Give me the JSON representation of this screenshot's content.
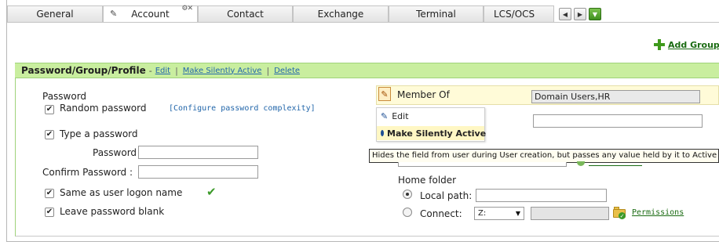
{
  "tabs": [
    {
      "label": "General",
      "active": false
    },
    {
      "label": "Account",
      "active": true
    },
    {
      "label": "Contact",
      "active": false
    },
    {
      "label": "Exchange",
      "active": false
    },
    {
      "label": "Terminal",
      "active": false
    },
    {
      "label": "LCS/OCS",
      "active": false
    }
  ],
  "tab_nav": {
    "prev_icon": "arrow-left-icon",
    "next_icon": "arrow-right-icon",
    "download_icon": "download-icon"
  },
  "toolbar": {
    "add_group_label": "Add Group"
  },
  "section": {
    "title": "Password/Group/Profile",
    "title_sep": "-",
    "actions": [
      "Edit",
      "Make Silently Active",
      "Delete"
    ],
    "action_sep": "|"
  },
  "password": {
    "heading": "Password",
    "random_label": "Random password",
    "random_checked": true,
    "configure_link": "[Configure password complexity]",
    "type_label": "Type a password",
    "type_checked": true,
    "password_label": "Password :",
    "password_value": "",
    "confirm_label": "Confirm Password :",
    "confirm_value": "",
    "same_label": "Same as user logon name",
    "same_checked": true,
    "blank_label": "Leave password blank",
    "blank_checked": true
  },
  "member": {
    "label": "Member Of",
    "value": "Domain Users,HR"
  },
  "context_menu": {
    "items": [
      "Edit",
      "Make Silently Active"
    ],
    "highlighted": "Make Silently Active"
  },
  "tooltip": "Hides the field from user during User creation, but passes any value held by it to Active Di",
  "home_folder": {
    "heading": "Home folder",
    "local_label": "Local path:",
    "local_value": "",
    "local_selected": true,
    "connect_label": "Connect:",
    "connect_selected": false,
    "drive_value": "Z:",
    "permissions_label": "Permissions"
  },
  "colors": {
    "section_bg": "#c9ee9f",
    "link_blue": "#2266aa",
    "link_green": "#1a6b12",
    "tooltip_bg": "#fffdf0",
    "highlight_bg": "#fff7c4"
  }
}
